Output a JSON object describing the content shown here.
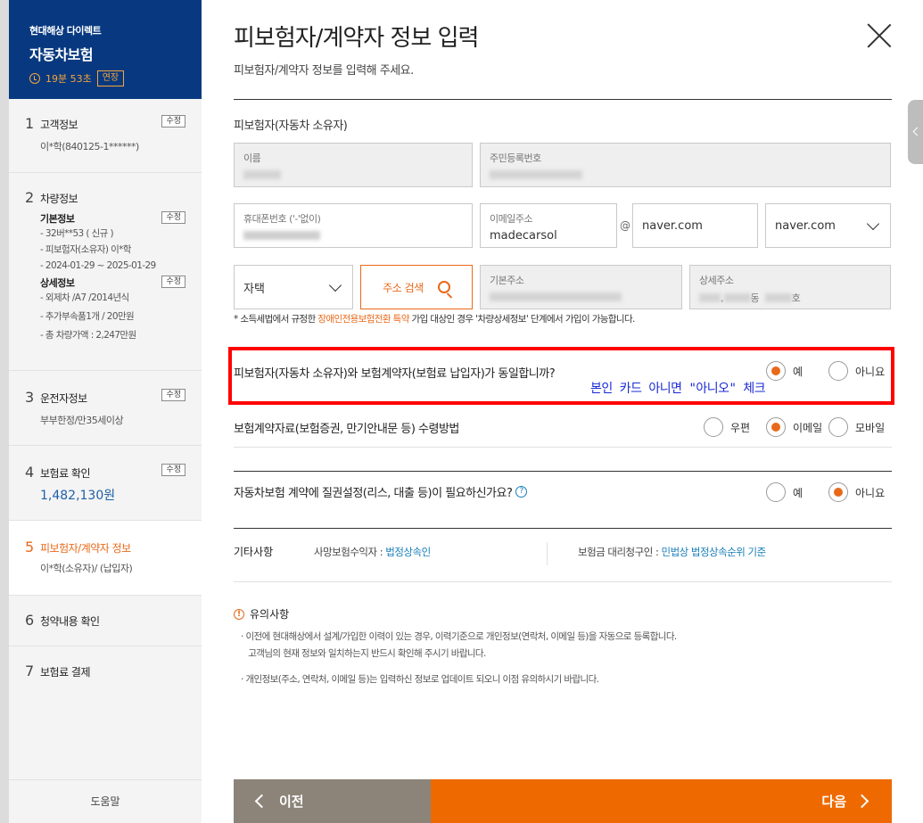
{
  "sidebar": {
    "brand": "현대해상 다이렉트",
    "product": "자동차보험",
    "timer": "19분 53초",
    "extend_label": "연장",
    "edit_label": "수정",
    "steps": [
      {
        "num": "1",
        "label": "고객정보",
        "sub": "이*학(840125-1******)"
      },
      {
        "num": "2",
        "label": "차량정보",
        "basic_head": "기본정보",
        "basic_lines": [
          "- 32버**53 ( 신규 )",
          "- 피보험자(소유자) 이*학",
          "- 2024-01-29 ~ 2025-01-29"
        ],
        "detail_head": "상세정보",
        "detail_lines": [
          "- 외제차 /A7 /2014년식",
          "- 추가부속품1개 / 20만원",
          "- 총 차량가액 : 2,247만원"
        ]
      },
      {
        "num": "3",
        "label": "운전자정보",
        "sub": "부부한정/만35세이상"
      },
      {
        "num": "4",
        "label": "보험료 확인",
        "sub": "1,482,130원"
      },
      {
        "num": "5",
        "label": "피보험자/계약자 정보",
        "sub": "이*학(소유자)/ (납입자)"
      },
      {
        "num": "6",
        "label": "청약내용 확인"
      },
      {
        "num": "7",
        "label": "보험료 결제"
      }
    ],
    "help": "도움말"
  },
  "main": {
    "title": "피보험자/계약자 정보 입력",
    "subtitle": "피보험자/계약자 정보를 입력해 주세요.",
    "section_label": "피보험자(자동차 소유자)",
    "fields": {
      "name_label": "이름",
      "rrn_label": "주민등록번호",
      "phone_label": "휴대폰번호 ('-'없이)",
      "email_label": "이메일주소",
      "email_id": "madecarsol",
      "at": "@",
      "email_domain": "naver.com",
      "email_domain_select": "naver.com",
      "addr_type": "자택",
      "addr_search": "주소 검색",
      "base_addr_label": "기본주소",
      "detail_addr_label": "상세주소",
      "detail_addr_partial_1": ",",
      "detail_addr_partial_2": "동",
      "detail_addr_partial_3": "호"
    },
    "note_pre": "* 소득세법에서 규정한 ",
    "note_hl": "장애인전용보험전환 특약",
    "note_post": " 가입 대상인 경우 '차량상세정보' 단계에서 가입이 가능합니다.",
    "q1": {
      "text": "피보험자(자동차 소유자)와 보험계약자(보험료 납입자)가 동일합니까?",
      "opt_yes": "예",
      "opt_no": "아니요",
      "selected": "yes"
    },
    "annotation": "본인 카드 아니면 \"아니오\" 체크",
    "q2": {
      "text": "보험계약자료(보험증권, 만기안내문 등) 수령방법",
      "opt_mail": "우편",
      "opt_email": "이메일",
      "opt_mobile": "모바일",
      "selected": "email"
    },
    "q3": {
      "text": "자동차보험 계약에 질권설정(리스, 대출 등)이 필요하신가요?",
      "opt_yes": "예",
      "opt_no": "아니요",
      "selected": "no"
    },
    "etc": {
      "label": "기타사항",
      "beneficiary_label": "사망보험수익자 : ",
      "beneficiary_value": "법정상속인",
      "claimant_label": "보험금 대리청구인 : ",
      "claimant_value": "민법상 법정상속순위 기준"
    },
    "notice": {
      "icon": "!",
      "title": "유의사항",
      "lines": [
        "·  이전에 현대해상에서 설계/가입한 이력이 있는 경우, 이력기준으로 개인정보(연락처, 이메일 등)을 자동으로 등록합니다.",
        "   고객님의 현재 정보와 일치하는지 반드시 확인해 주시기 바랍니다.",
        "·  개인정보(주소, 연락처, 이메일 등)는 입력하신 정보로 업데이트 되오니 이점 유의하시기 바랍니다."
      ]
    },
    "prev_label": "이전",
    "next_label": "다음"
  },
  "colors": {
    "navy": "#083980",
    "accent": "#e9691a",
    "next_bg": "#ee6a00",
    "prev_bg": "#8c8479",
    "annotation": "#ff0000",
    "annotation_text": "#1a2ad6"
  }
}
